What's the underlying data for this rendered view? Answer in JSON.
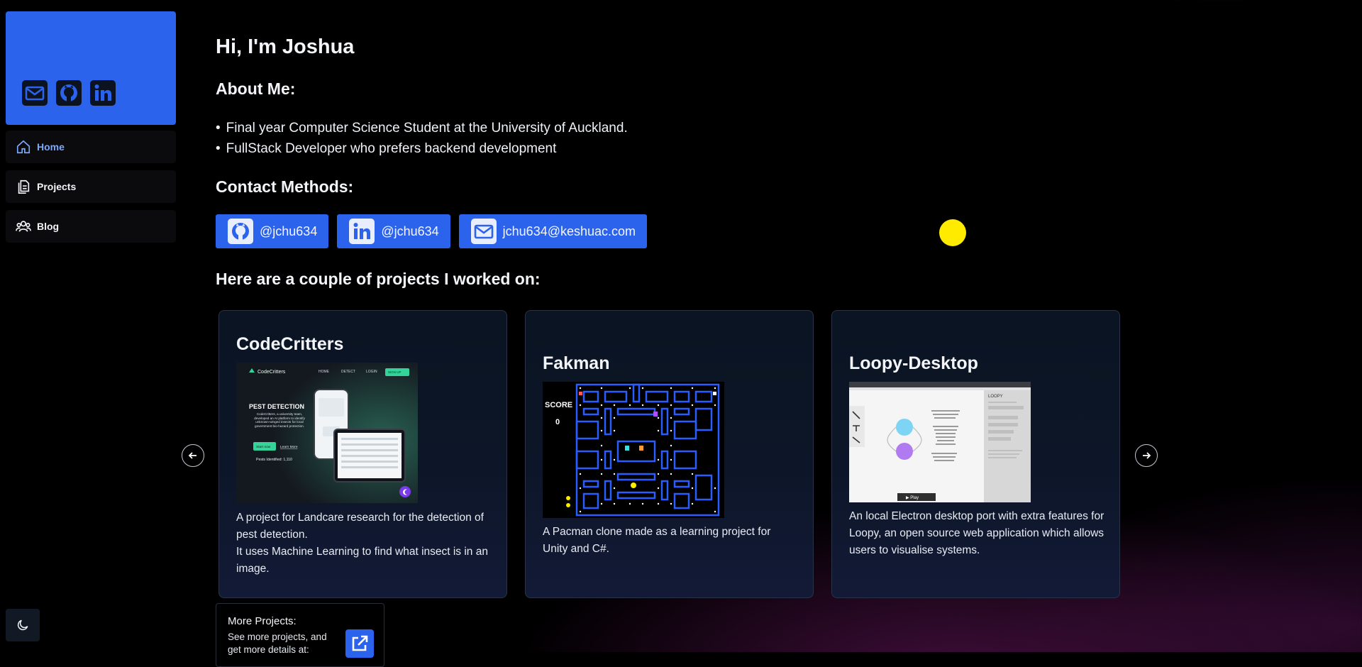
{
  "sidebar": {
    "social_icons": [
      "mail-icon",
      "github-icon",
      "linkedin-icon"
    ],
    "nav": [
      {
        "label": "Home",
        "icon": "home-icon",
        "active": true
      },
      {
        "label": "Projects",
        "icon": "documents-icon",
        "active": false
      },
      {
        "label": "Blog",
        "icon": "users-icon",
        "active": false
      }
    ],
    "theme_icon": "moon-icon"
  },
  "main": {
    "title": "Hi, I'm Joshua",
    "about_heading": "About Me:",
    "about_items": [
      "Final year Computer Science Student at the University of Auckland.",
      "FullStack Developer who prefers backend development"
    ],
    "contact_heading": "Contact Methods:",
    "contacts": [
      {
        "icon": "github-icon",
        "label": "@jchu634"
      },
      {
        "icon": "linkedin-icon",
        "label": "@jchu634"
      },
      {
        "icon": "mail-icon",
        "label": "jchu634@keshuac.com"
      }
    ],
    "projects_heading": "Here are a couple of projects I worked on:",
    "projects": [
      {
        "title": "CodeCritters",
        "desc_lines": [
          "A project for Landcare research for the detection of pest detection.",
          "It uses Machine Learning to find what insect is in an image."
        ],
        "shot": {
          "brand": "CodeCritters",
          "nav": [
            "HOME",
            "DETECT",
            "LOGIN",
            "SIGN UP"
          ],
          "headline": "PEST DETECTION",
          "blurb": "CodeCritters, a university team, developed an AI platform to identify unknown-winged insects for local government bio-hazard protection.",
          "btn_start": "Start now",
          "btn_learn": "Learn More",
          "counter": "Pests Identified: 1,110"
        }
      },
      {
        "title": "Fakman",
        "desc_lines": [
          "A Pacman clone made as a learning project for Unity and C#."
        ],
        "shot": {
          "score_label": "SCORE",
          "score_value": "0"
        }
      },
      {
        "title": "Loopy-Desktop",
        "desc_lines": [
          "An local Electron desktop port with extra features for Loopy, an open source web application which allows users to visualise systems."
        ],
        "shot": {
          "panel_title": "LOOPY",
          "play_label": "▶ Play"
        }
      }
    ],
    "more": {
      "title": "More Projects:",
      "desc": "See more projects, and get more details at:",
      "icon": "external-link-icon"
    }
  },
  "colors": {
    "accent": "#2c63ec",
    "active_nav": "#7aa9ff",
    "pointer": "#ffeb00"
  }
}
